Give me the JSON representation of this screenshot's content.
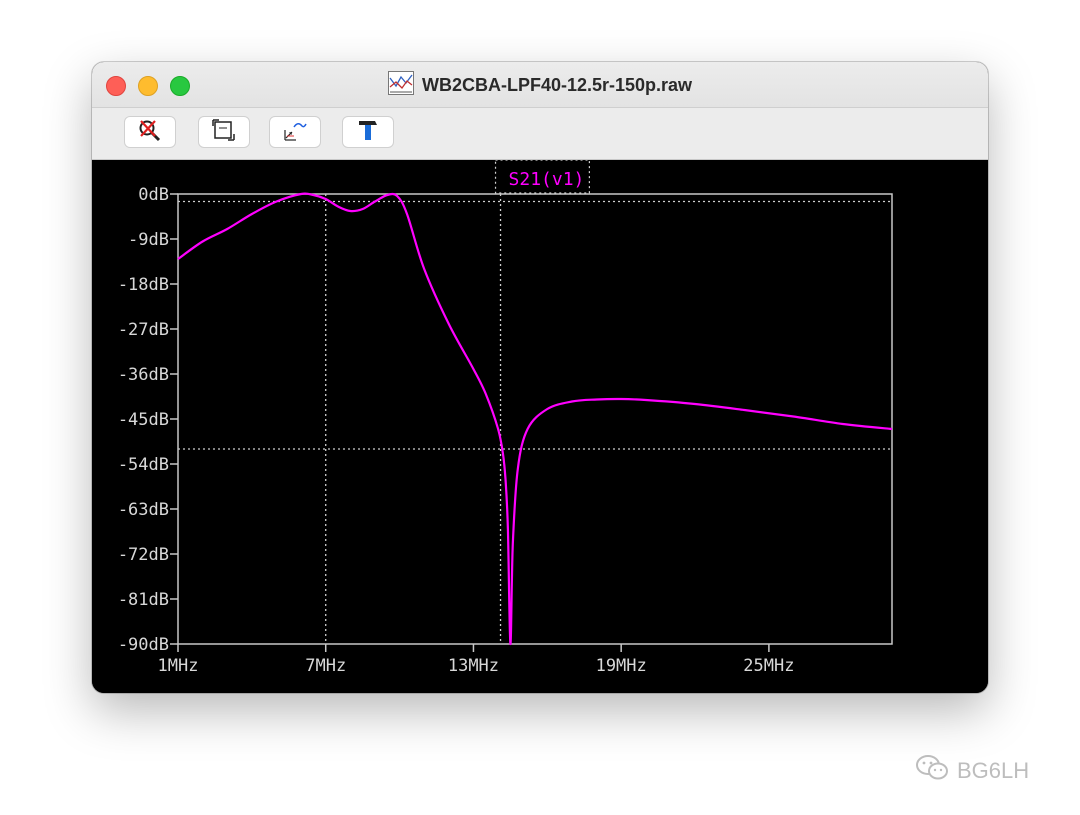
{
  "window": {
    "title": "WB2CBA-LPF40-12.5r-150p.raw"
  },
  "toolbar": {
    "buttons": [
      {
        "icon": "zoom-cancel-icon"
      },
      {
        "icon": "autorange-icon"
      },
      {
        "icon": "view-plot-icon"
      },
      {
        "icon": "hammer-icon"
      }
    ]
  },
  "watermark": {
    "text": "BG6LH",
    "icon": "wechat-icon"
  },
  "chart_data": {
    "type": "line",
    "title": "S21(v1)",
    "xlabel": "",
    "ylabel": "",
    "xlim": [
      1,
      30
    ],
    "ylim": [
      -90,
      0
    ],
    "x_ticks": [
      1,
      7,
      13,
      19,
      25
    ],
    "x_tick_labels": [
      "1MHz",
      "7MHz",
      "13MHz",
      "19MHz",
      "25MHz"
    ],
    "y_ticks": [
      0,
      -9,
      -18,
      -27,
      -36,
      -45,
      -54,
      -63,
      -72,
      -81,
      -90
    ],
    "y_tick_labels": [
      "0dB",
      "-9dB",
      "-18dB",
      "-27dB",
      "-36dB",
      "-45dB",
      "-54dB",
      "-63dB",
      "-72dB",
      "-81dB",
      "-90dB"
    ],
    "cursor_lines": {
      "x": [
        7,
        14.1
      ],
      "y": [
        -1.5,
        -51
      ]
    },
    "background": "#000000",
    "grid_color": "#d0d0d0",
    "series": [
      {
        "color": "#ff00ff",
        "x": [
          1,
          2,
          3,
          4,
          5,
          6,
          6.5,
          7,
          7.5,
          8,
          8.5,
          9,
          9.5,
          9.9,
          10.3,
          11,
          12,
          13,
          13.5,
          14,
          14.2,
          14.3,
          14.4,
          14.5,
          14.6,
          14.8,
          15.2,
          16,
          17,
          18,
          19,
          20,
          22,
          24,
          26,
          28,
          30
        ],
        "y": [
          -13,
          -9.5,
          -7,
          -4,
          -1.5,
          0,
          -0.2,
          -1,
          -2.5,
          -3.4,
          -3,
          -1.5,
          -0.2,
          -0.4,
          -4,
          -15,
          -26,
          -35,
          -40,
          -47,
          -52,
          -57,
          -67,
          -90,
          -70,
          -55,
          -47,
          -43,
          -41.5,
          -41.1,
          -41,
          -41.2,
          -42,
          -43.2,
          -44.5,
          -46,
          -47
        ]
      }
    ]
  }
}
